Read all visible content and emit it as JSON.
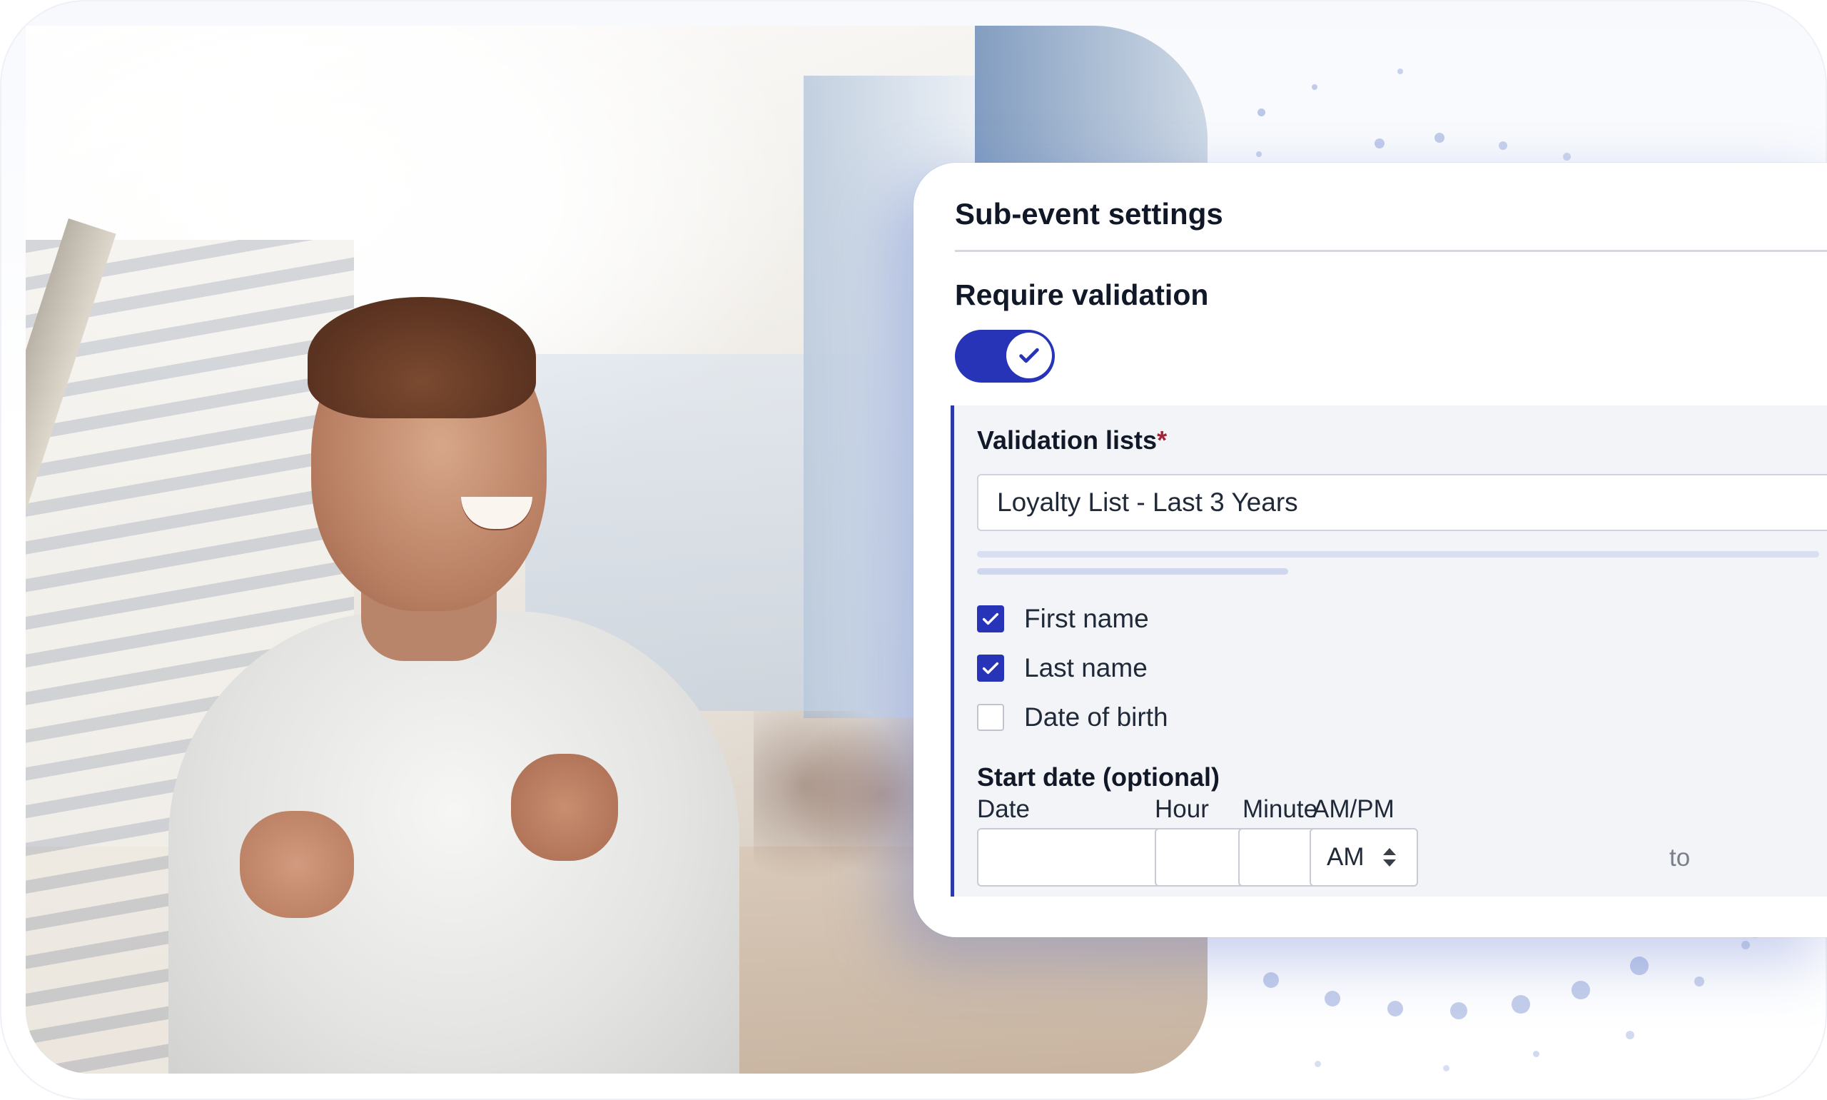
{
  "card": {
    "title": "Sub-event settings",
    "require_validation": {
      "title": "Require validation",
      "enabled": true
    },
    "validation_lists": {
      "label": "Validation lists",
      "required_mark": "*",
      "selected": "Loyalty List - Last 3 Years"
    },
    "fields": [
      {
        "label": "First name",
        "checked": true
      },
      {
        "label": "Last name",
        "checked": true
      },
      {
        "label": "Date of birth",
        "checked": false
      }
    ],
    "start_date": {
      "title": "Start date (optional)",
      "date_label": "Date",
      "hour_label": "Hour",
      "minute_label": "Minute",
      "ampm_label": "AM/PM",
      "date_value": "",
      "hour_value": "",
      "minute_value": "",
      "ampm_value": "AM",
      "separator": ":",
      "to_label": "to"
    }
  },
  "colors": {
    "accent": "#2734b8",
    "panel_border": "#2a3aa8",
    "required": "#a02435",
    "dots": "#7f95d3"
  }
}
